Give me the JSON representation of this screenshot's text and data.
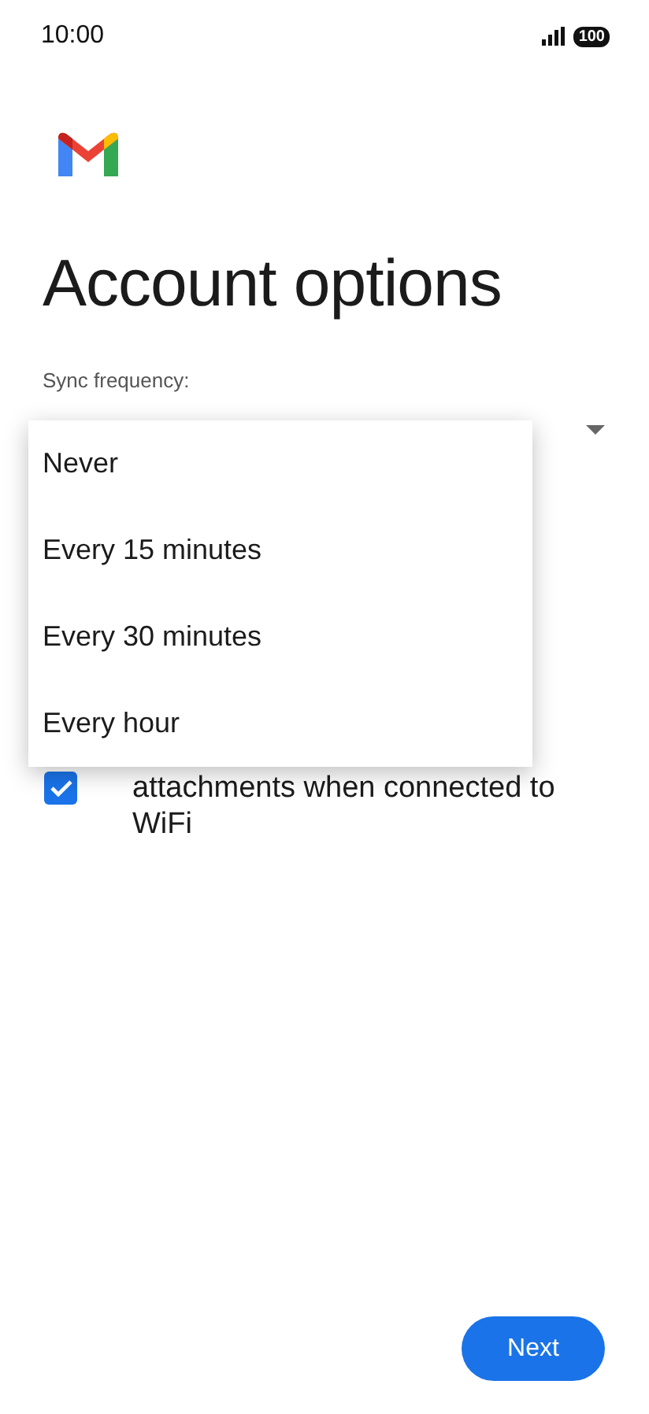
{
  "status_bar": {
    "time": "10:00",
    "battery": "100"
  },
  "title": "Account options",
  "sync_frequency": {
    "label": "Sync frequency:",
    "menu_open": true,
    "options": [
      {
        "label": "Never"
      },
      {
        "label": "Every 15 minutes"
      },
      {
        "label": "Every 30 minutes"
      },
      {
        "label": "Every hour"
      }
    ]
  },
  "checkbox": {
    "label": "attachments when connected to WiFi",
    "checked": true
  },
  "next_button": "Next"
}
